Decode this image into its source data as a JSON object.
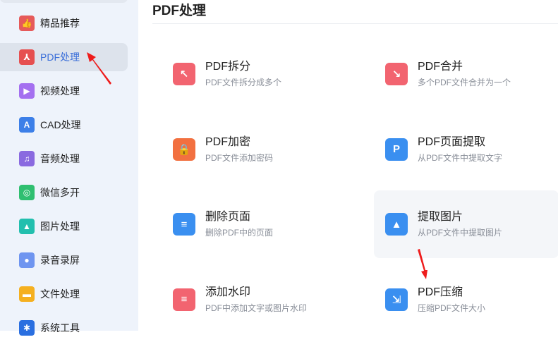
{
  "sidebar": {
    "items": [
      {
        "label": "精品推荐",
        "icon": "thumbs-up-icon",
        "color": "#e65a5a"
      },
      {
        "label": "PDF处理",
        "icon": "pdf-icon",
        "color": "#e65050"
      },
      {
        "label": "视频处理",
        "icon": "play-icon",
        "color": "#a470f0"
      },
      {
        "label": "CAD处理",
        "icon": "cad-icon",
        "color": "#3c7fe8"
      },
      {
        "label": "音频处理",
        "icon": "music-icon",
        "color": "#8a6ae0"
      },
      {
        "label": "微信多开",
        "icon": "wechat-icon",
        "color": "#2fbf70"
      },
      {
        "label": "图片处理",
        "icon": "image-icon",
        "color": "#22bfae"
      },
      {
        "label": "录音录屏",
        "icon": "microphone-icon",
        "color": "#6f95f0"
      },
      {
        "label": "文件处理",
        "icon": "folder-icon",
        "color": "#f5b020"
      },
      {
        "label": "系统工具",
        "icon": "gear-icon",
        "color": "#2a6fe0"
      }
    ]
  },
  "main": {
    "title": "PDF处理",
    "tools": [
      {
        "title": "PDF拆分",
        "desc": "PDF文件拆分成多个",
        "icon": "split-icon",
        "color": "#f26470"
      },
      {
        "title": "PDF合并",
        "desc": "多个PDF文件合并为一个",
        "icon": "merge-icon",
        "color": "#f26470"
      },
      {
        "title": "PDF加密",
        "desc": "PDF文件添加密码",
        "icon": "lock-icon",
        "color": "#f27040"
      },
      {
        "title": "PDF页面提取",
        "desc": "从PDF文件中提取文字",
        "icon": "page-extract-icon",
        "color": "#3a8ff0"
      },
      {
        "title": "删除页面",
        "desc": "删除PDF中的页面",
        "icon": "delete-page-icon",
        "color": "#3a8ff0"
      },
      {
        "title": "提取图片",
        "desc": "从PDF文件中提取图片",
        "icon": "image-extract-icon",
        "color": "#3a8ff0"
      },
      {
        "title": "添加水印",
        "desc": "PDF中添加文字或图片水印",
        "icon": "watermark-icon",
        "color": "#f26470"
      },
      {
        "title": "PDF压缩",
        "desc": "压缩PDF文件大小",
        "icon": "compress-icon",
        "color": "#3a8ff0"
      }
    ]
  }
}
